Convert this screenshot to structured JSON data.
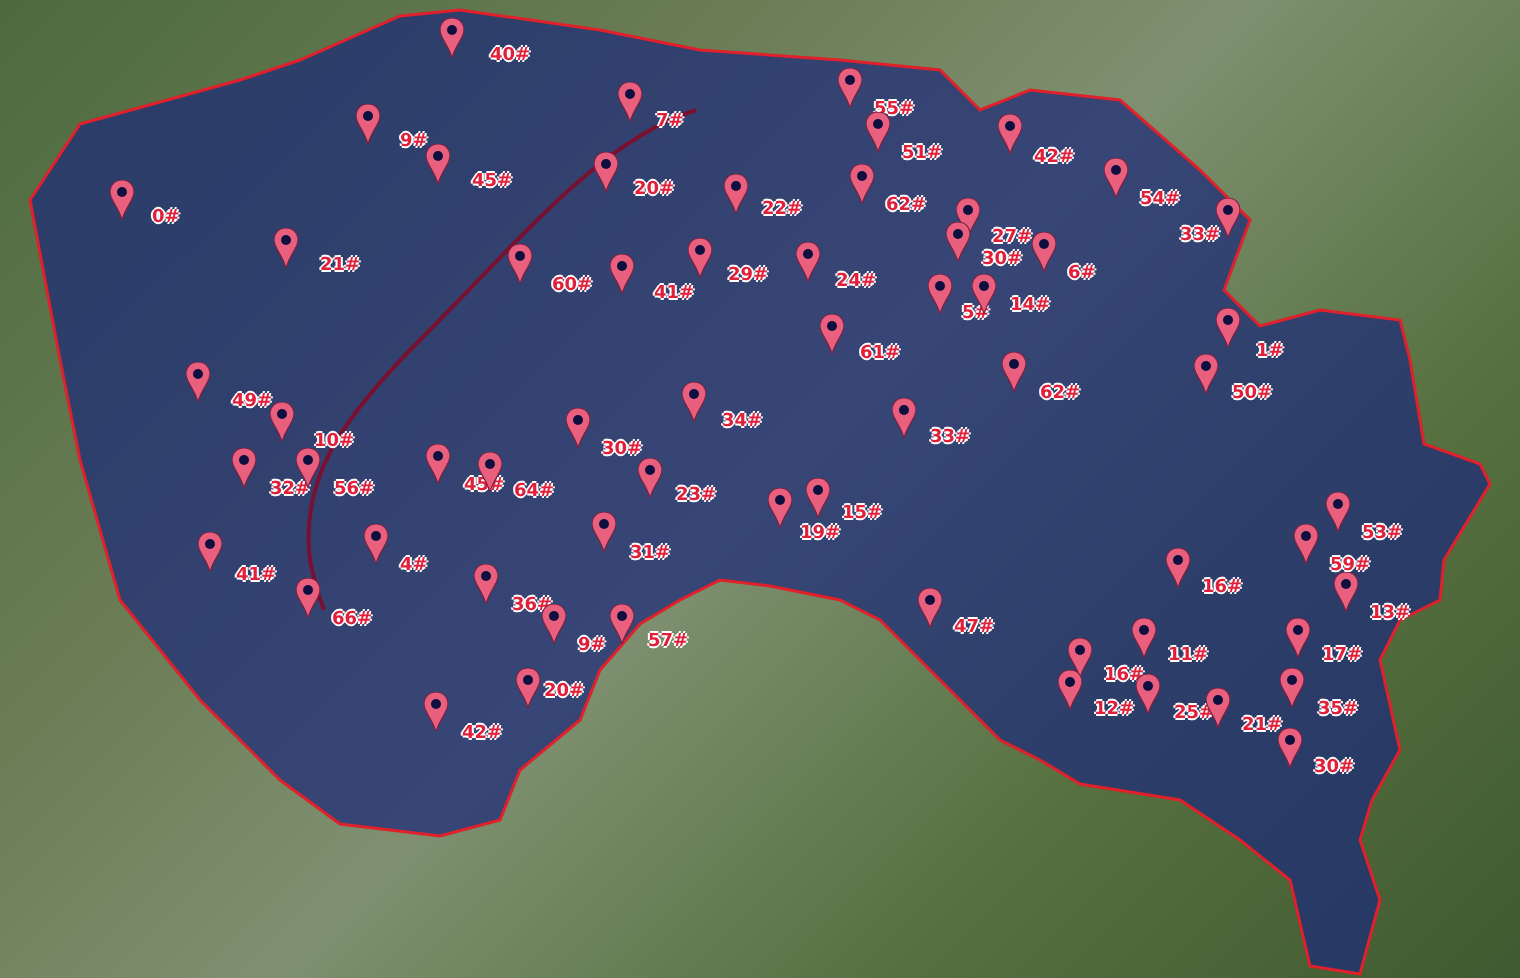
{
  "map": {
    "pins": [
      {
        "label": "40#"
      },
      {
        "label": "7#"
      },
      {
        "label": "9#"
      },
      {
        "label": "45#"
      },
      {
        "label": "20#"
      },
      {
        "label": "0#"
      },
      {
        "label": "21#"
      },
      {
        "label": "60#"
      },
      {
        "label": "41#"
      },
      {
        "label": "22#"
      },
      {
        "label": "29#"
      },
      {
        "label": "55#"
      },
      {
        "label": "51#"
      },
      {
        "label": "42#"
      },
      {
        "label": "62#"
      },
      {
        "label": "54#"
      },
      {
        "label": "27#"
      },
      {
        "label": "30#"
      },
      {
        "label": "6#"
      },
      {
        "label": "24#"
      },
      {
        "label": "5#"
      },
      {
        "label": "14#"
      },
      {
        "label": "61#"
      },
      {
        "label": "33#"
      },
      {
        "label": "1#"
      },
      {
        "label": "62#"
      },
      {
        "label": "50#"
      },
      {
        "label": "33#"
      },
      {
        "label": "49#"
      },
      {
        "label": "10#"
      },
      {
        "label": "30#"
      },
      {
        "label": "34#"
      },
      {
        "label": "32#"
      },
      {
        "label": "56#"
      },
      {
        "label": "45#"
      },
      {
        "label": "64#"
      },
      {
        "label": "23#"
      },
      {
        "label": "41#"
      },
      {
        "label": "4#"
      },
      {
        "label": "66#"
      },
      {
        "label": "36#"
      },
      {
        "label": "9#"
      },
      {
        "label": "57#"
      },
      {
        "label": "31#"
      },
      {
        "label": "20#"
      },
      {
        "label": "42#"
      },
      {
        "label": "19#"
      },
      {
        "label": "15#"
      },
      {
        "label": "53#"
      },
      {
        "label": "59#"
      },
      {
        "label": "16#"
      },
      {
        "label": "13#"
      },
      {
        "label": "47#"
      },
      {
        "label": "11#"
      },
      {
        "label": "17#"
      },
      {
        "label": "16#"
      },
      {
        "label": "12#"
      },
      {
        "label": "25#"
      },
      {
        "label": "21#"
      },
      {
        "label": "35#"
      },
      {
        "label": "30#"
      }
    ]
  }
}
